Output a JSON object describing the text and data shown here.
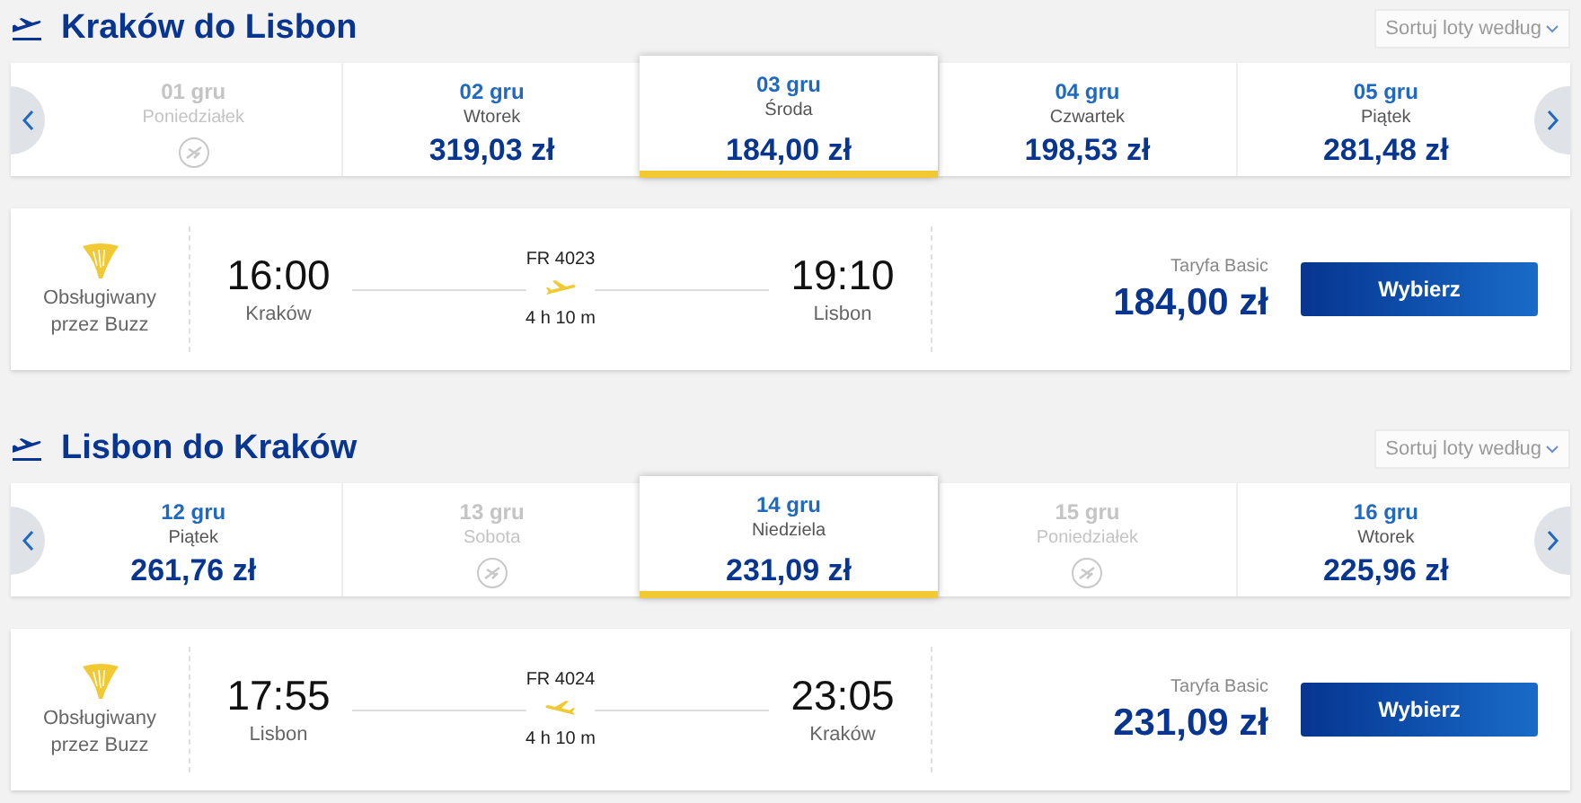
{
  "sections": [
    {
      "title": "Kraków do Lisbon",
      "sort_label": "Sortuj loty według",
      "kind": "outbound",
      "dates": [
        {
          "date": "01 gru",
          "weekday": "Poniedziałek",
          "available": false,
          "selected": false
        },
        {
          "date": "02 gru",
          "weekday": "Wtorek",
          "price": "319,03 zł",
          "available": true,
          "selected": false
        },
        {
          "date": "03 gru",
          "weekday": "Środa",
          "price": "184,00 zł",
          "available": true,
          "selected": true
        },
        {
          "date": "04 gru",
          "weekday": "Czwartek",
          "price": "198,53 zł",
          "available": true,
          "selected": false
        },
        {
          "date": "05 gru",
          "weekday": "Piątek",
          "price": "281,48 zł",
          "available": true,
          "selected": false
        }
      ],
      "flight": {
        "operator": "Obsługiwany przez Buzz",
        "depart_time": "16:00",
        "depart_city": "Kraków",
        "flight_number": "FR 4023",
        "duration": "4 h 10 m",
        "arrive_time": "19:10",
        "arrive_city": "Lisbon",
        "fare_label": "Taryfa Basic",
        "price": "184,00 zł",
        "button": "Wybierz"
      }
    },
    {
      "title": "Lisbon do Kraków",
      "sort_label": "Sortuj loty według",
      "kind": "return",
      "dates": [
        {
          "date": "12 gru",
          "weekday": "Piątek",
          "price": "261,76 zł",
          "available": true,
          "selected": false
        },
        {
          "date": "13 gru",
          "weekday": "Sobota",
          "available": false,
          "selected": false
        },
        {
          "date": "14 gru",
          "weekday": "Niedziela",
          "price": "231,09 zł",
          "available": true,
          "selected": true
        },
        {
          "date": "15 gru",
          "weekday": "Poniedziałek",
          "available": false,
          "selected": false
        },
        {
          "date": "16 gru",
          "weekday": "Wtorek",
          "price": "225,96 zł",
          "available": true,
          "selected": false
        }
      ],
      "flight": {
        "operator": "Obsługiwany przez Buzz",
        "depart_time": "17:55",
        "depart_city": "Lisbon",
        "flight_number": "FR 4024",
        "duration": "4 h 10 m",
        "arrive_time": "23:05",
        "arrive_city": "Kraków",
        "fare_label": "Taryfa Basic",
        "price": "231,09 zł",
        "button": "Wybierz"
      }
    }
  ]
}
